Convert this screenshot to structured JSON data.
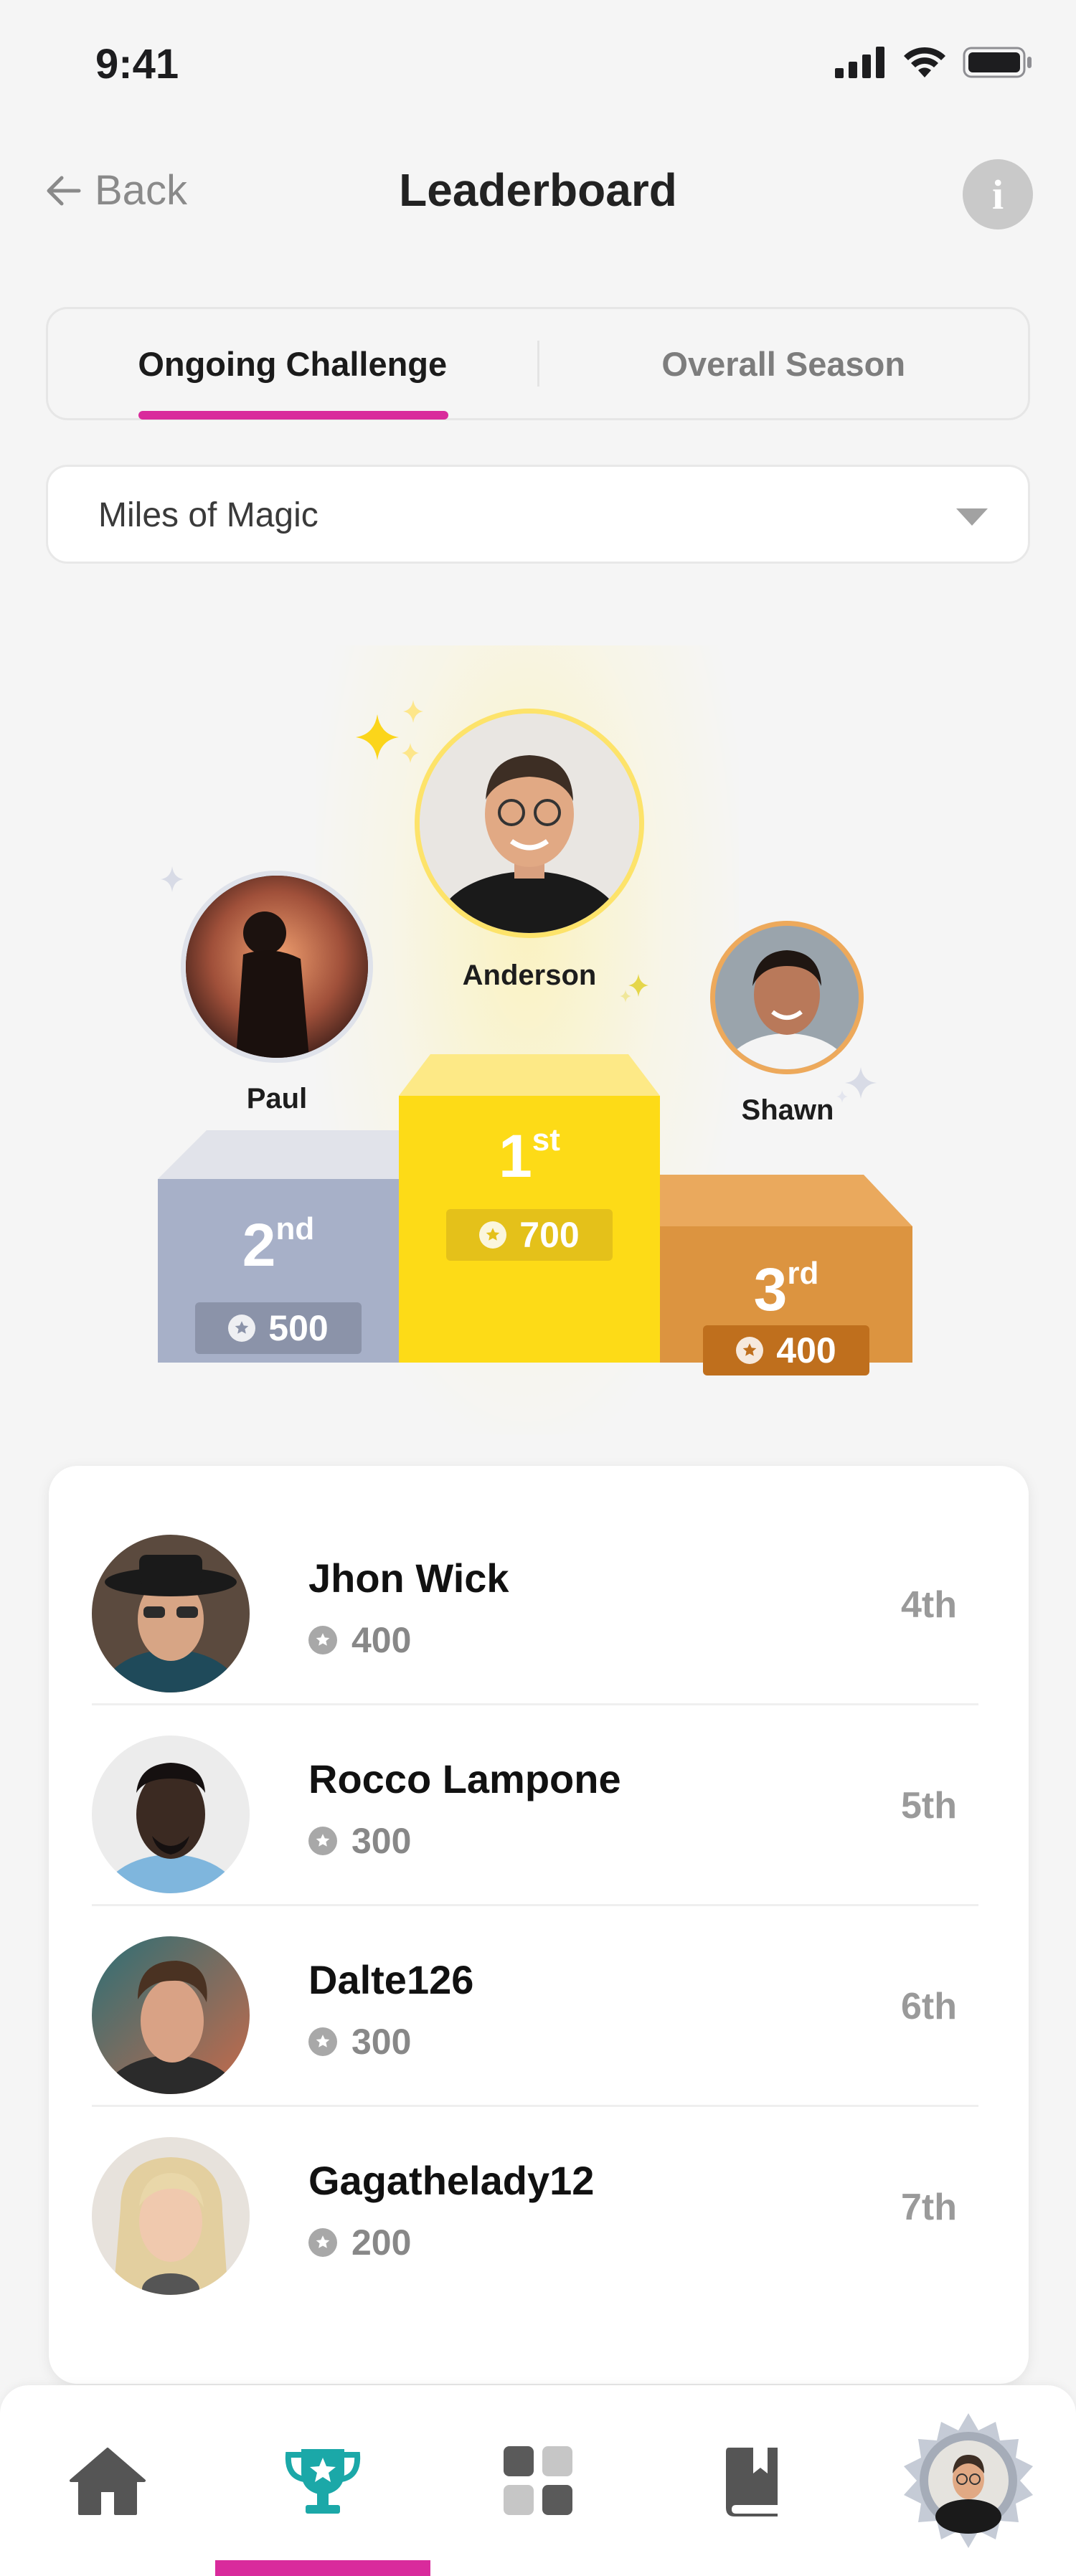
{
  "status": {
    "time": "9:41"
  },
  "header": {
    "back_label": "Back",
    "title": "Leaderboard"
  },
  "tabs": [
    {
      "label": "Ongoing Challenge",
      "active": true
    },
    {
      "label": "Overall Season",
      "active": false
    }
  ],
  "challenge_select": {
    "value": "Miles of Magic"
  },
  "podium": {
    "first": {
      "name": "Anderson",
      "rank": "1",
      "suffix": "st",
      "points": "700"
    },
    "second": {
      "name": "Paul",
      "rank": "2",
      "suffix": "nd",
      "points": "500"
    },
    "third": {
      "name": "Shawn",
      "rank": "3",
      "suffix": "rd",
      "points": "400"
    }
  },
  "list": [
    {
      "name": "Jhon Wick",
      "points": "400",
      "position": "4th"
    },
    {
      "name": "Rocco Lampone",
      "points": "300",
      "position": "5th"
    },
    {
      "name": "Dalte126",
      "points": "300",
      "position": "6th"
    },
    {
      "name": "Gagathelady12",
      "points": "200",
      "position": "7th"
    }
  ],
  "nav": [
    {
      "icon": "home-icon",
      "active": false
    },
    {
      "icon": "trophy-icon",
      "active": true
    },
    {
      "icon": "grid-icon",
      "active": false
    },
    {
      "icon": "book-icon",
      "active": false
    },
    {
      "icon": "profile-badge-icon",
      "active": false
    }
  ],
  "colors": {
    "accent": "#d92b9c",
    "gold": "#fddb17",
    "silver": "#a7b0c8",
    "bronze": "#dc9440",
    "trophy": "#1ba8a8"
  }
}
